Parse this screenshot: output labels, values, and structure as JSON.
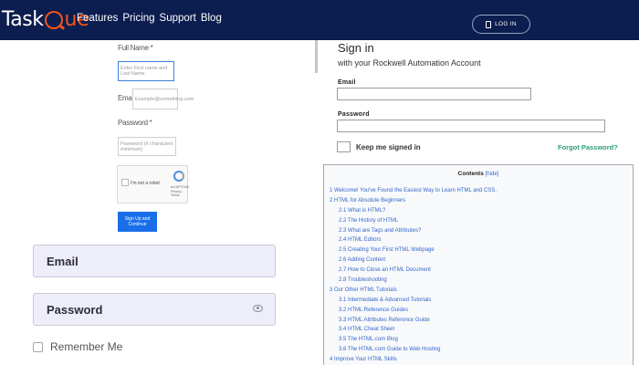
{
  "header": {
    "logo_main": "Task",
    "logo_accent": "ue",
    "nav": [
      "Features",
      "Pricing",
      "Support",
      "Blog"
    ],
    "login_label": "LOG IN"
  },
  "signup": {
    "fullname_label": "Full Name *",
    "fullname_placeholder": "Enter First name and Last Name",
    "email_label": "Email *",
    "email_placeholder": "Example@something.com",
    "password_label": "Password *",
    "password_placeholder": "Password (6 characters minimum)",
    "recaptcha_text": "I'm not a robot",
    "recaptcha_brand": "reCAPTCHA",
    "recaptcha_terms": "Privacy - Terms",
    "submit_label": "Sign Up and Continue"
  },
  "login_form": {
    "email_placeholder": "Email",
    "password_placeholder": "Password",
    "remember_label": "Remember Me"
  },
  "signin": {
    "title": "Sign in",
    "subtitle": "with your Rockwell Automation Account",
    "email_label": "Email",
    "password_label": "Password",
    "keep_signed_in": "Keep me signed in",
    "forgot_label": "Forgot Password?"
  },
  "toc": {
    "title": "Contents",
    "hide_label": "[hide]",
    "items": [
      {
        "text": "1 Welcome! You've Found the Easiest Way to Learn HTML and CSS.",
        "level": 1
      },
      {
        "text": "2 HTML for Absolute Beginners",
        "level": 1
      },
      {
        "text": "2.1 What is HTML?",
        "level": 2
      },
      {
        "text": "2.2 The History of HTML",
        "level": 2
      },
      {
        "text": "2.3 What are Tags and Attributes?",
        "level": 2
      },
      {
        "text": "2.4 HTML Editors",
        "level": 2
      },
      {
        "text": "2.5 Creating Your First HTML Webpage",
        "level": 2
      },
      {
        "text": "2.6 Adding Content",
        "level": 2
      },
      {
        "text": "2.7 How to Close an HTML Document",
        "level": 2
      },
      {
        "text": "2.8 Troubleshooting",
        "level": 2
      },
      {
        "text": "3 Our Other HTML Tutorials",
        "level": 1
      },
      {
        "text": "3.1 Intermediate & Advanced Tutorials",
        "level": 2
      },
      {
        "text": "3.2 HTML Reference Guides",
        "level": 2
      },
      {
        "text": "3.3 HTML Attributes Reference Guide",
        "level": 2
      },
      {
        "text": "3.4 HTML Cheat Sheet",
        "level": 2
      },
      {
        "text": "3.5 The HTML.com Blog",
        "level": 2
      },
      {
        "text": "3.6 The HTML.com Guide to Web Hosting",
        "level": 2
      },
      {
        "text": "4 Improve Your HTML Skills",
        "level": 1
      }
    ]
  }
}
